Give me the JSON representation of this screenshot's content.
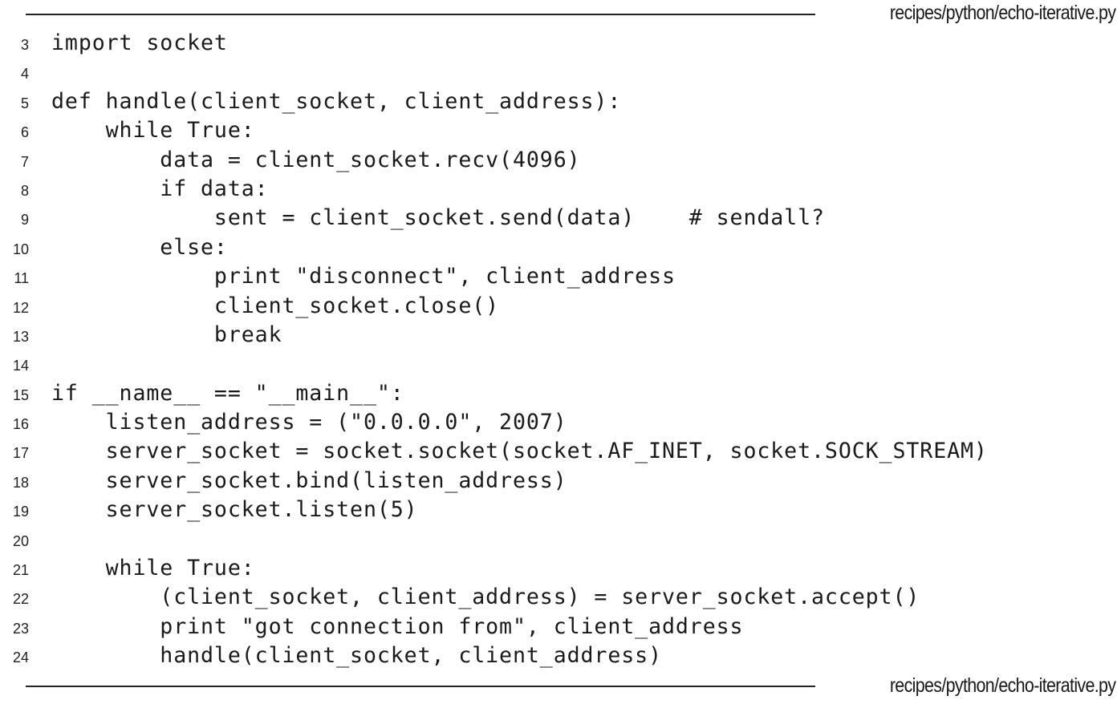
{
  "listing": {
    "filename_top": "recipes/python/echo-iterative.py",
    "filename_bottom": "recipes/python/echo-iterative.py",
    "lines": [
      {
        "number": "3",
        "code": "import socket"
      },
      {
        "number": "4",
        "code": ""
      },
      {
        "number": "5",
        "code": "def handle(client_socket, client_address):"
      },
      {
        "number": "6",
        "code": "    while True:"
      },
      {
        "number": "7",
        "code": "        data = client_socket.recv(4096)"
      },
      {
        "number": "8",
        "code": "        if data:"
      },
      {
        "number": "9",
        "code": "            sent = client_socket.send(data)    # sendall?"
      },
      {
        "number": "10",
        "code": "        else:"
      },
      {
        "number": "11",
        "code": "            print \"disconnect\", client_address"
      },
      {
        "number": "12",
        "code": "            client_socket.close()"
      },
      {
        "number": "13",
        "code": "            break"
      },
      {
        "number": "14",
        "code": ""
      },
      {
        "number": "15",
        "code": "if __name__ == \"__main__\":"
      },
      {
        "number": "16",
        "code": "    listen_address = (\"0.0.0.0\", 2007)"
      },
      {
        "number": "17",
        "code": "    server_socket = socket.socket(socket.AF_INET, socket.SOCK_STREAM)"
      },
      {
        "number": "18",
        "code": "    server_socket.bind(listen_address)"
      },
      {
        "number": "19",
        "code": "    server_socket.listen(5)"
      },
      {
        "number": "20",
        "code": ""
      },
      {
        "number": "21",
        "code": "    while True:"
      },
      {
        "number": "22",
        "code": "        (client_socket, client_address) = server_socket.accept()"
      },
      {
        "number": "23",
        "code": "        print \"got connection from\", client_address"
      },
      {
        "number": "24",
        "code": "        handle(client_socket, client_address)"
      }
    ]
  }
}
